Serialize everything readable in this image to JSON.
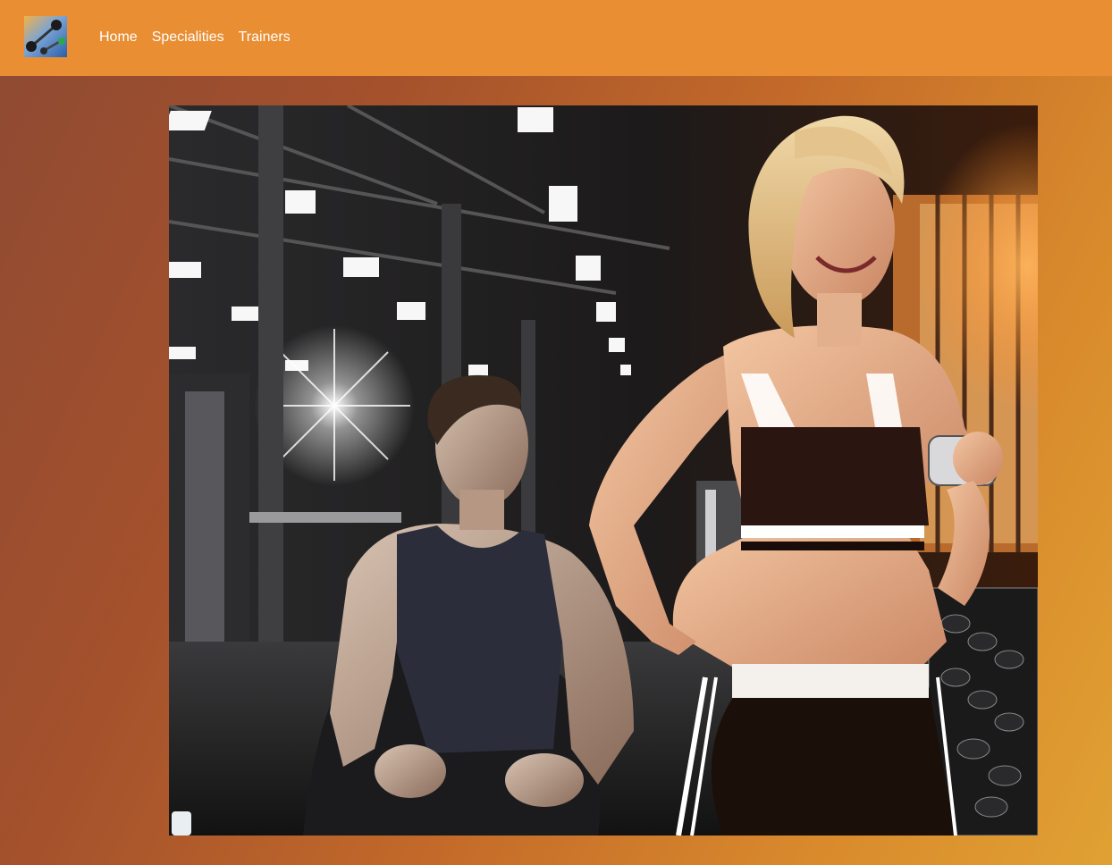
{
  "nav": {
    "logo_icon": "dumbbells-logo-icon",
    "links": [
      {
        "label": "Home"
      },
      {
        "label": "Specialities"
      },
      {
        "label": "Trainers"
      }
    ]
  },
  "hero": {
    "image_icon": "gym-trainers-photo"
  },
  "colors": {
    "navbar": "#e98e33",
    "background_start": "#8e4a33",
    "background_end": "#e0a133",
    "link_text": "#ffffff"
  }
}
